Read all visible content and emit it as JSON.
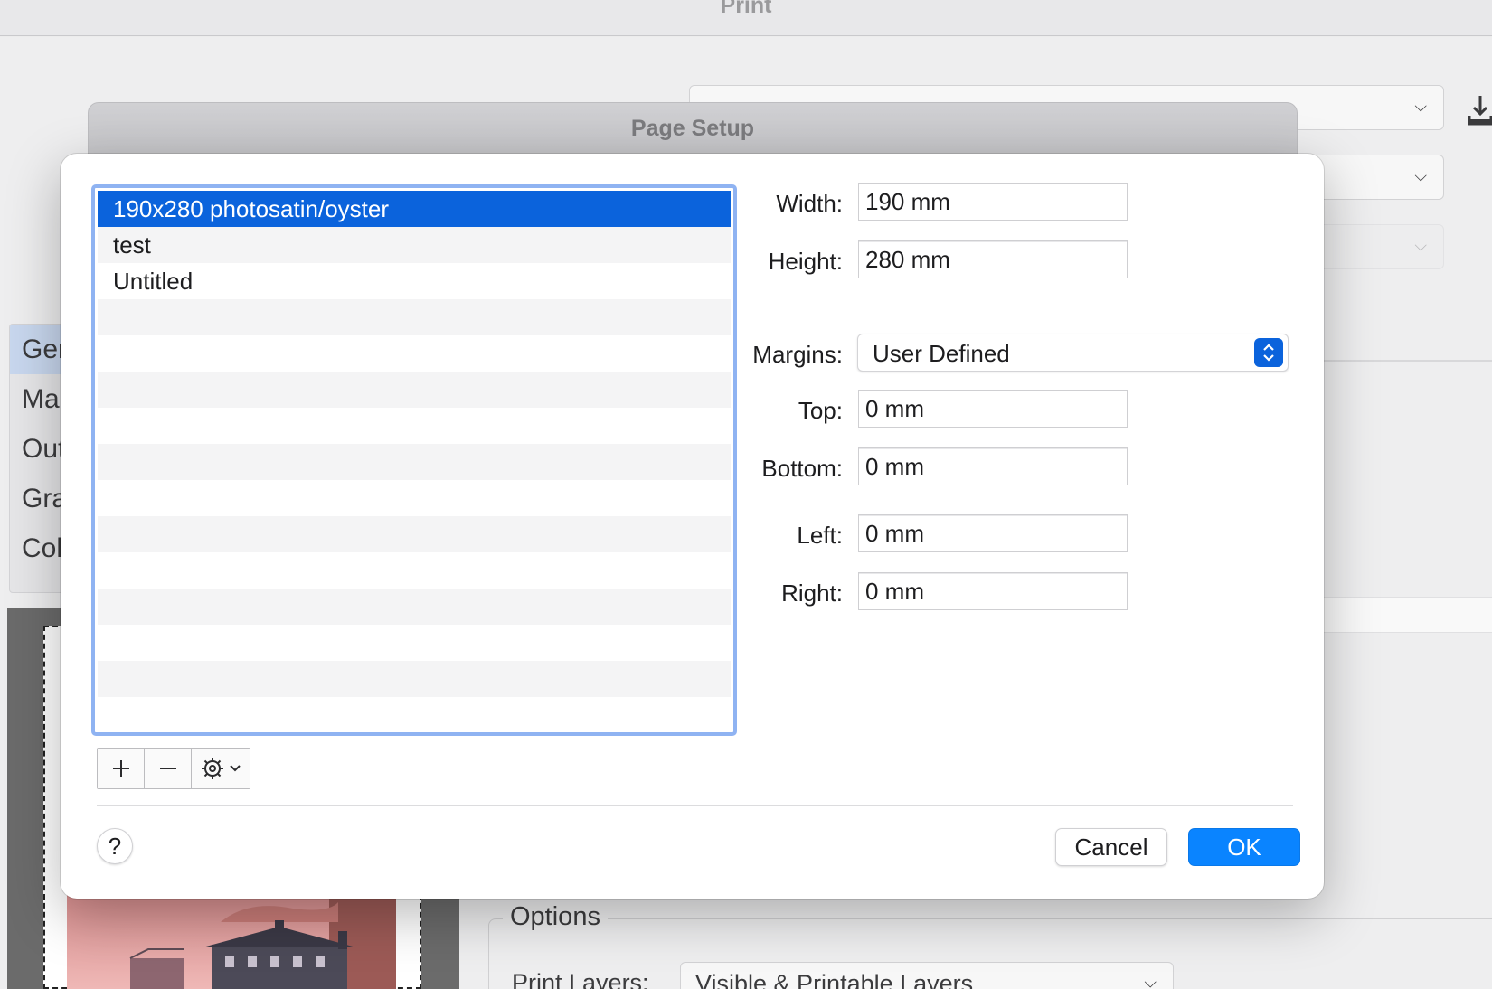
{
  "print_window": {
    "title": "Print",
    "sidebar_items": [
      "Ger",
      "Ma",
      "Out",
      "Gra",
      "Col"
    ],
    "options_title": "Options",
    "print_layers_label": "Print Layers:",
    "print_layers_value": "Visible & Printable Layers"
  },
  "page_setup": {
    "title": "Page Setup",
    "list_items": [
      "190x280 photosatin/oyster",
      "test",
      "Untitled",
      "",
      "",
      "",
      "",
      "",
      "",
      "",
      "",
      "",
      "",
      "",
      ""
    ],
    "selected_index": 0,
    "fields": {
      "width_label": "Width:",
      "width_value": "190 mm",
      "height_label": "Height:",
      "height_value": "280 mm",
      "margins_label": "Margins:",
      "margins_value": "User Defined",
      "top_label": "Top:",
      "top_value": "0 mm",
      "bottom_label": "Bottom:",
      "bottom_value": "0 mm",
      "left_label": "Left:",
      "left_value": "0 mm",
      "right_label": "Right:",
      "right_value": "0 mm"
    },
    "buttons": {
      "help": "?",
      "cancel": "Cancel",
      "ok": "OK"
    },
    "colors": {
      "accent": "#0a84ff",
      "selection": "#0b63dc",
      "focus_ring": "#8fb3f2"
    }
  }
}
